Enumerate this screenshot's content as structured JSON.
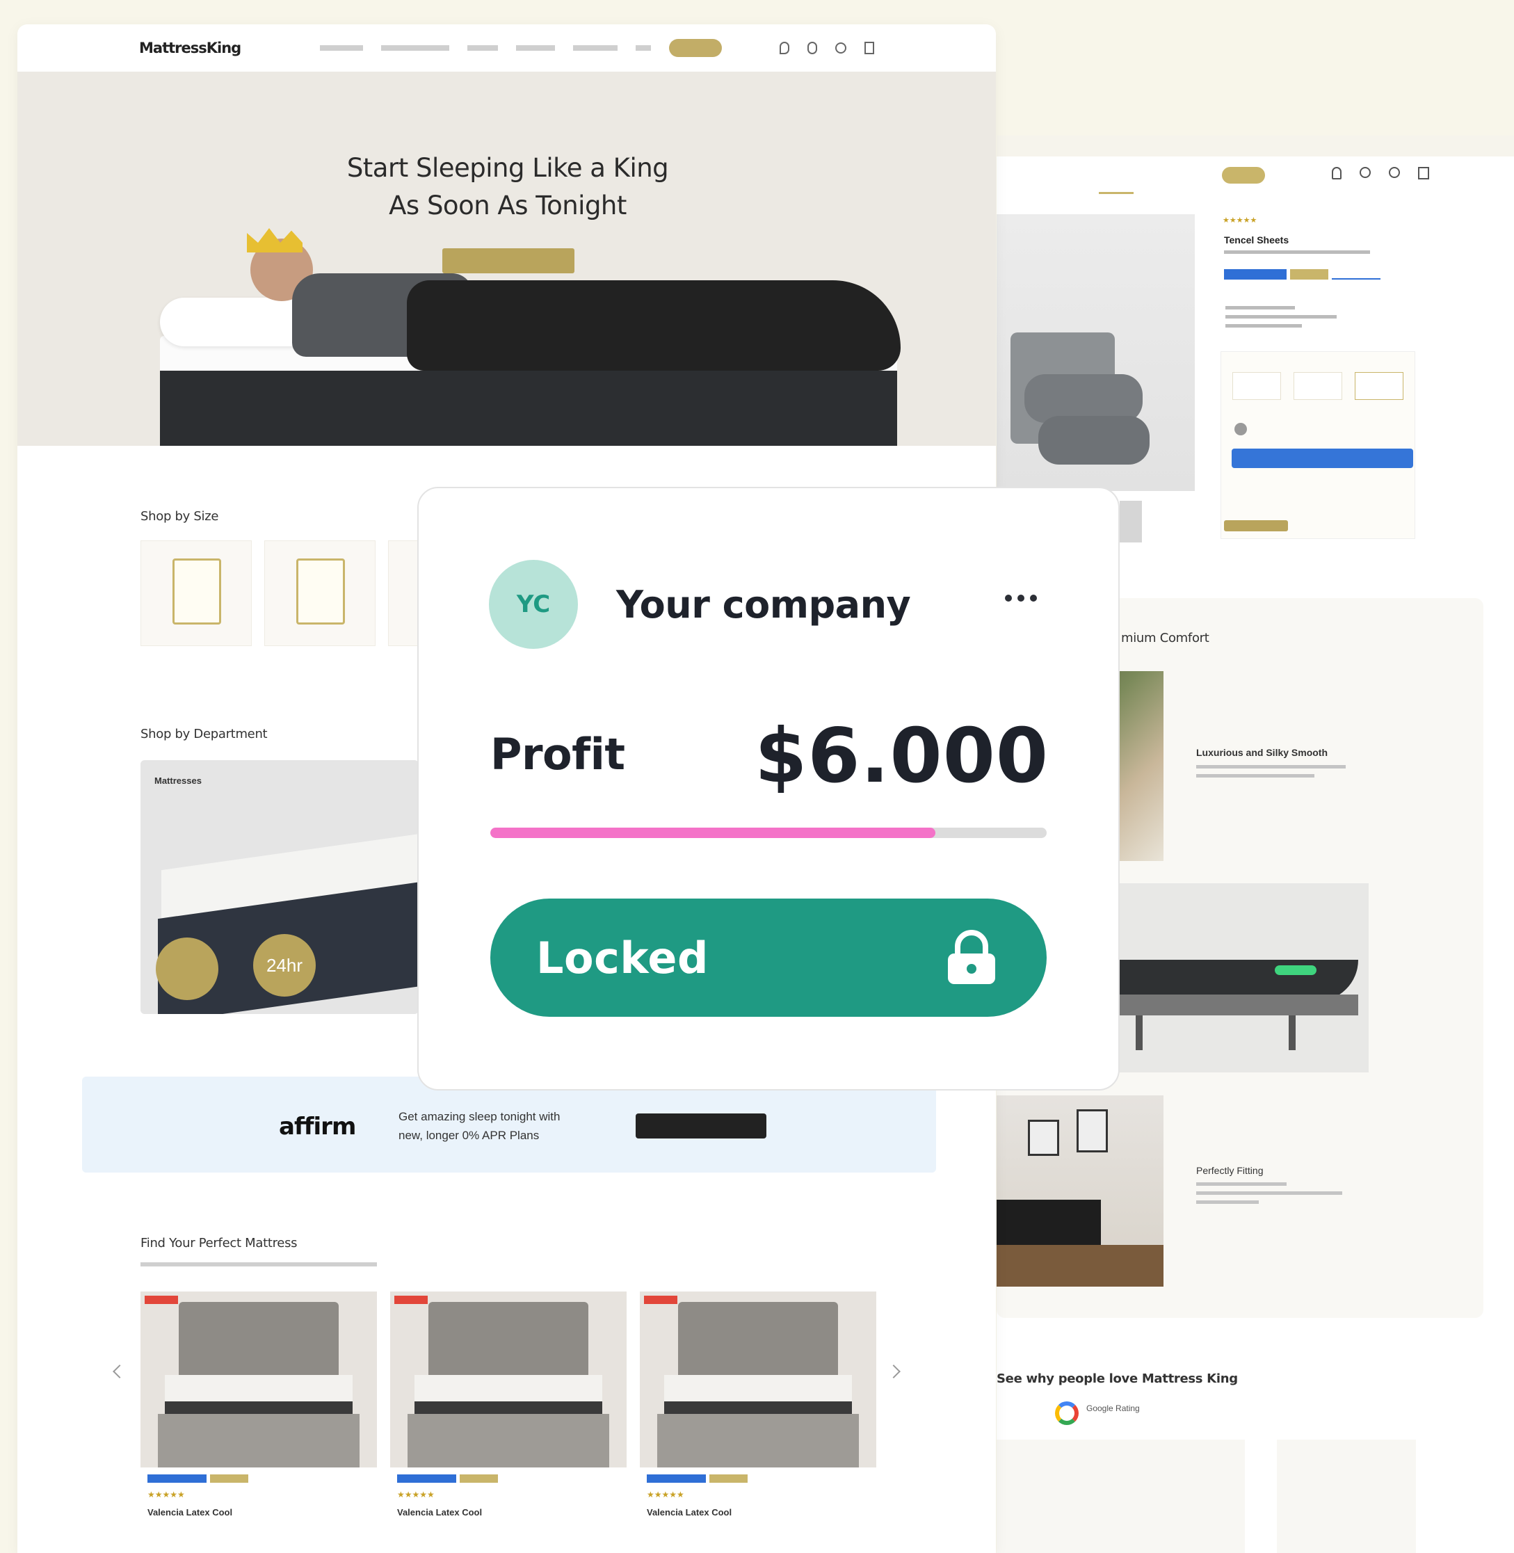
{
  "left_site": {
    "topbar": {
      "phone": "",
      "links": [
        "",
        "",
        "",
        ""
      ]
    },
    "logo": "MattressKing",
    "nav": {
      "items": [
        "",
        "",
        "",
        "",
        "",
        ""
      ],
      "cta": ""
    },
    "hero": {
      "title_line1": "Start Sleeping Like a King",
      "title_line2": "As Soon As Tonight",
      "cta": ""
    },
    "shop_by_size": {
      "title": "Shop by Size",
      "cards": [
        {
          "label": ""
        },
        {
          "label": ""
        },
        {
          "label": ""
        }
      ]
    },
    "shop_by_department": {
      "title": "Shop by Department",
      "card_title": "Mattresses",
      "card_subtitle": "",
      "badge1": "",
      "badge2": "24hr"
    },
    "affirm": {
      "logo": "affirm",
      "text_line1": "Get amazing sleep tonight with",
      "text_line2": "new, longer 0% APR Plans",
      "button": ""
    },
    "find_mattress": {
      "title": "Find Your Perfect Mattress",
      "subtitle": "",
      "products": [
        {
          "name": "Valencia Latex Cool"
        },
        {
          "name": "Valencia Latex Cool"
        },
        {
          "name": "Valencia Latex Cool"
        }
      ]
    }
  },
  "right_site": {
    "product": {
      "title": "Tencel Sheets",
      "add_button": ""
    },
    "comfort": {
      "title": "mium Comfort",
      "feature1": "Luxurious and Silky Smooth",
      "feature2": "Perfectly Fitting"
    },
    "reviews": {
      "title": "See why people love Mattress King",
      "source": "Google Rating"
    }
  },
  "card": {
    "avatar_initials": "YC",
    "company_name": "Your company",
    "more_icon": "more-horizontal-icon",
    "profit_label": "Profit",
    "profit_value": "$6.000",
    "progress_fraction": 0.8,
    "progress_color": "#f472c8",
    "button_label": "Locked",
    "button_icon": "lock-icon",
    "button_color": "#1f9a83",
    "avatar_color": "#b7e3d8"
  }
}
